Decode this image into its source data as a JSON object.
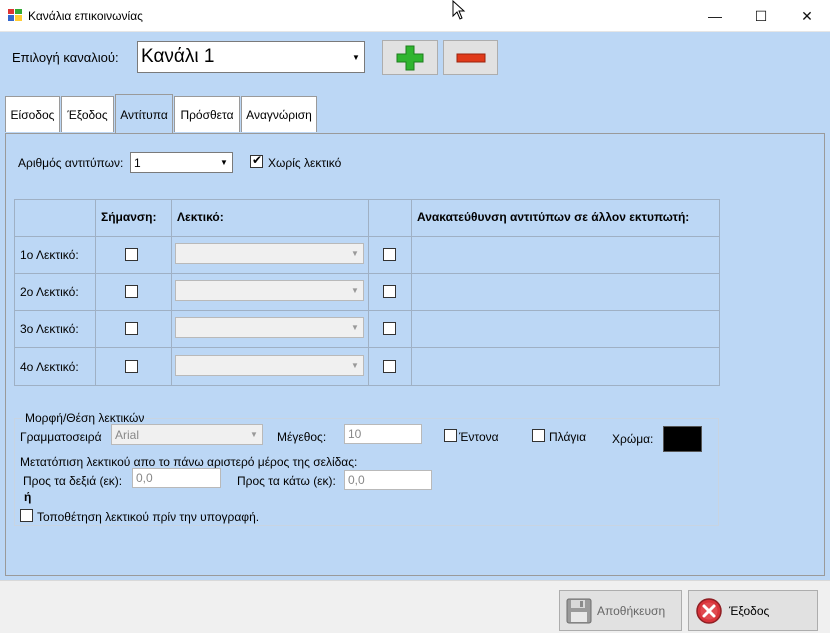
{
  "window": {
    "title": "Κανάλια επικοινωνίας",
    "minimize": "—",
    "maximize": "☐",
    "close": "✕"
  },
  "channel": {
    "label": "Επιλογή καναλιού:",
    "selected": "Κανάλι 1",
    "add_icon": "plus-icon",
    "remove_icon": "minus-icon"
  },
  "tabs": [
    {
      "label": "Είσοδος",
      "active": false
    },
    {
      "label": "Έξοδος",
      "active": false
    },
    {
      "label": "Αντίτυπα",
      "active": true
    },
    {
      "label": "Πρόσθετα",
      "active": false
    },
    {
      "label": "Αναγνώριση",
      "active": false
    }
  ],
  "copies": {
    "label": "Αριθμός αντιτύπων:",
    "value": "1",
    "no_label_checkbox": "Χωρίς λεκτικό",
    "no_label_checked": true
  },
  "grid": {
    "headers": {
      "mark": "Σήμανση:",
      "label": "Λεκτικό:",
      "redirect": "Ανακατεύθυνση αντιτύπων σε άλλον εκτυπωτή:"
    },
    "rows": [
      {
        "name": "1ο Λεκτικό:"
      },
      {
        "name": "2ο Λεκτικό:"
      },
      {
        "name": "3ο Λεκτικό:"
      },
      {
        "name": "4ο Λεκτικό:"
      }
    ]
  },
  "format": {
    "group_title": "Μορφή/Θέση λεκτικών",
    "font_label": "Γραμματοσειρά",
    "font_value": "Arial",
    "size_label": "Μέγεθος:",
    "size_value": "10",
    "bold_label": "Έντονα",
    "italic_label": "Πλάγια",
    "color_label": "Χρώμα:",
    "color_value": "#000000",
    "offset_label": "Μετατόπιση λεκτικού απο το πάνω αριστερό μέρος της σελίδας:",
    "right_label": "Προς τα δεξιά (εκ):",
    "right_value": "0,0",
    "down_label": "Προς τα κάτω (εκ):",
    "down_value": "0,0",
    "or_label": "ή",
    "before_sign_label": "Τοποθέτηση λεκτικού πρίν την υπογραφή."
  },
  "footer": {
    "save_label": "Αποθήκευση",
    "save_icon": "floppy-disk-icon",
    "exit_label": "Έξοδος",
    "exit_icon": "close-circle-icon"
  },
  "colors": {
    "form_bg": "#bcd7f5",
    "add_green": "#2fb52f",
    "remove_red": "#e03a1a"
  }
}
